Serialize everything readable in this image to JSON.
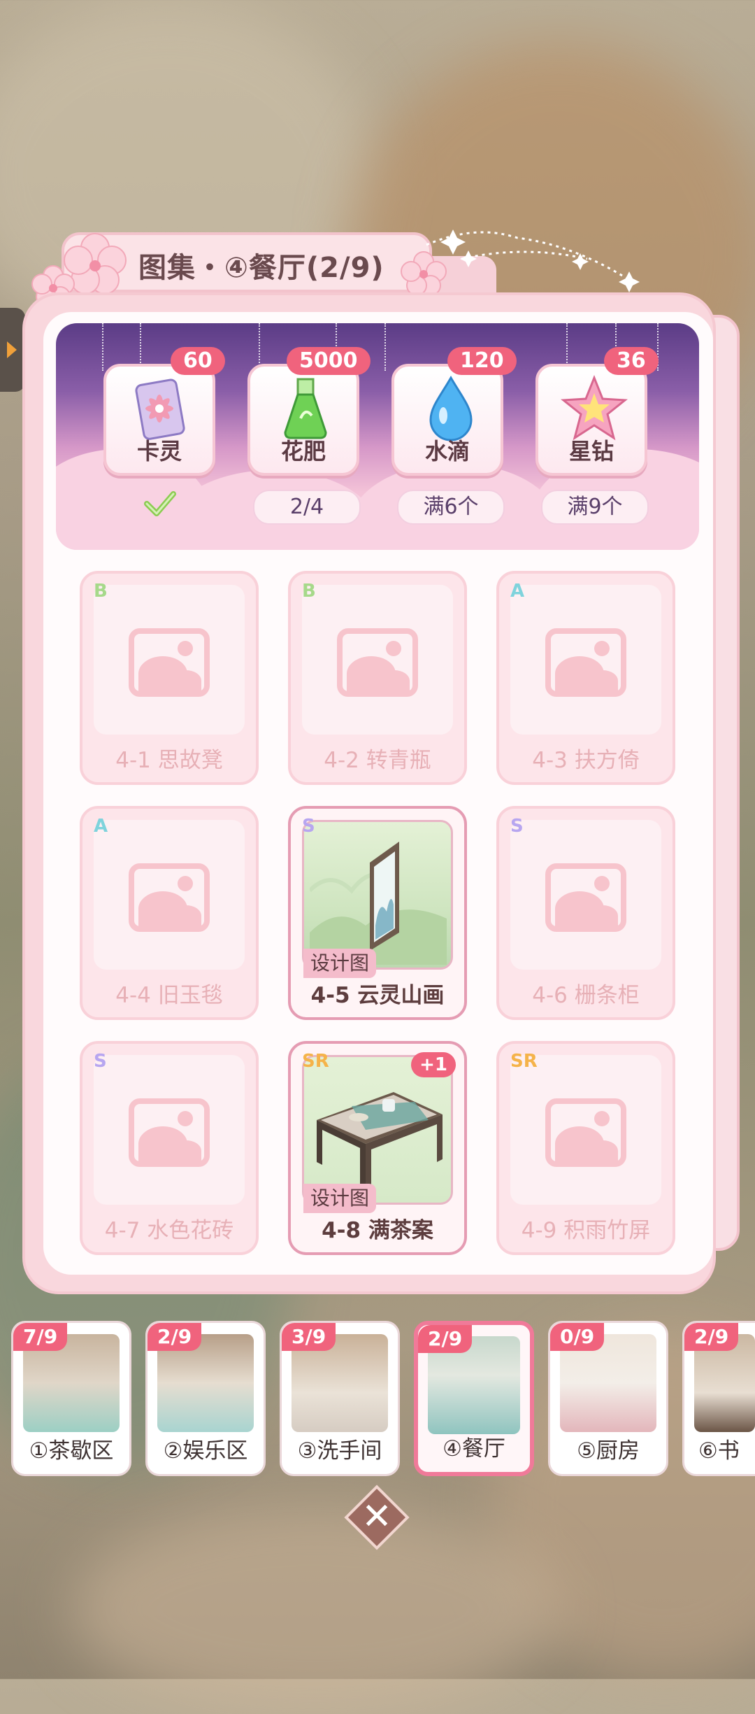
{
  "title": "图集・④餐厅(2/9)",
  "rewards": [
    {
      "name": "卡灵",
      "count": "60",
      "requirement": "",
      "claimed": true,
      "icon": "card-icon"
    },
    {
      "name": "花肥",
      "count": "5000",
      "requirement": "2/4",
      "claimed": false,
      "icon": "fertilizer-icon"
    },
    {
      "name": "水滴",
      "count": "120",
      "requirement": "满6个",
      "claimed": false,
      "icon": "water-drop-icon"
    },
    {
      "name": "星钻",
      "count": "36",
      "requirement": "满9个",
      "claimed": false,
      "icon": "star-diamond-icon"
    }
  ],
  "cards": [
    {
      "name": "4-1 思故凳",
      "rank": "B",
      "owned": false
    },
    {
      "name": "4-2 转青瓶",
      "rank": "B",
      "owned": false
    },
    {
      "name": "4-3 扶方倚",
      "rank": "A",
      "owned": false
    },
    {
      "name": "4-4 旧玉毯",
      "rank": "A",
      "owned": false
    },
    {
      "name": "4-5 云灵山画",
      "rank": "S",
      "owned": true,
      "tag": "设计图"
    },
    {
      "name": "4-6 栅条柜",
      "rank": "S",
      "owned": false
    },
    {
      "name": "4-7 水色花砖",
      "rank": "S",
      "owned": false
    },
    {
      "name": "4-8 满茶案",
      "rank": "SR",
      "owned": true,
      "tag": "设计图",
      "badge": "+1"
    },
    {
      "name": "4-9 积雨竹屏",
      "rank": "SR",
      "owned": false
    }
  ],
  "rooms": [
    {
      "name": "①茶歇区",
      "count": "7/9"
    },
    {
      "name": "②娱乐区",
      "count": "2/9"
    },
    {
      "name": "③洗手间",
      "count": "3/9"
    },
    {
      "name": "④餐厅",
      "count": "2/9",
      "active": true
    },
    {
      "name": "⑤厨房",
      "count": "0/9"
    },
    {
      "name": "⑥书",
      "count": "2/9"
    }
  ],
  "close_symbol": "✕",
  "colors": {
    "accent": "#f0637d",
    "rank_B": "#a6d98a",
    "rank_A": "#7fd3dc",
    "rank_S": "#b7a6f0",
    "rank_SR": "#f5b34a"
  }
}
